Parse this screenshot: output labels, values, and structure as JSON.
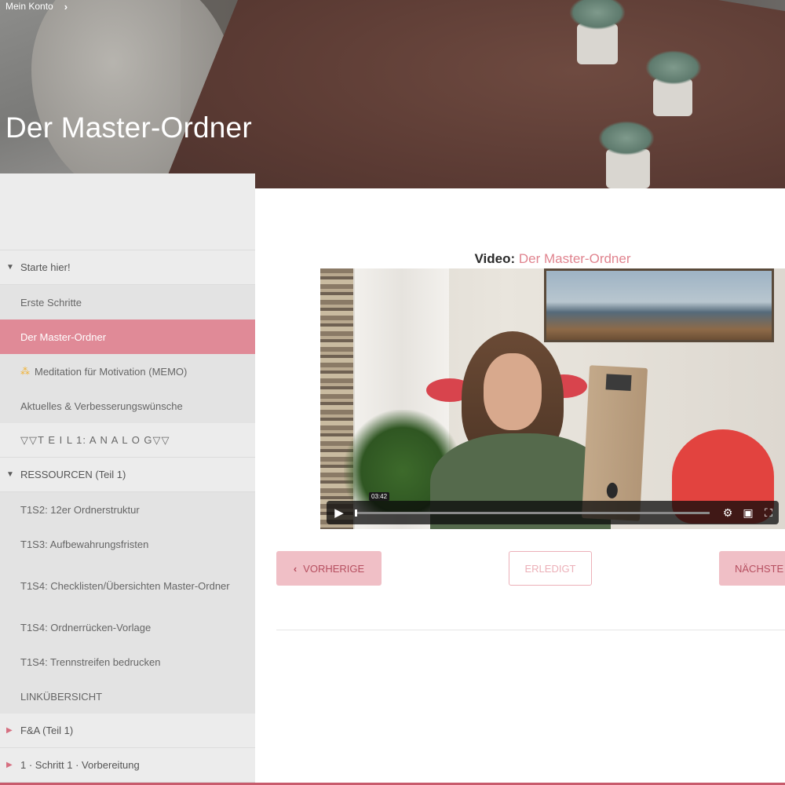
{
  "hero": {
    "breadcrumb": {
      "items": [
        {
          "label": "Mein Konto"
        }
      ],
      "separator_icon": "chevron-right-icon"
    },
    "title": "Der Master-Ordner"
  },
  "sidebar": {
    "sections": [
      {
        "label": "Starte hier!",
        "state": "expanded",
        "items": [
          {
            "label": "Erste Schritte"
          },
          {
            "label": "Der Master-Ordner",
            "active": true
          },
          {
            "label": "Meditation für Motivation (MEMO)",
            "icon": "triad-icon"
          },
          {
            "label": "Aktuelles & Verbesserungswünsche"
          },
          {
            "label": "▽▽T E I L 1: A N A L O G▽▽"
          }
        ]
      },
      {
        "label": "RESSOURCEN (Teil 1)",
        "state": "expanded",
        "items": [
          {
            "label": "T1S2: 12er Ordnerstruktur"
          },
          {
            "label": "T1S3: Aufbewahrungsfristen"
          },
          {
            "label": "T1S4: Checklisten/Übersichten Master-Ordner"
          },
          {
            "label": "T1S4: Ordnerrücken-Vorlage"
          },
          {
            "label": "T1S4: Trennstreifen bedrucken"
          },
          {
            "label": "LINKÜBERSICHT"
          }
        ]
      },
      {
        "label": "F&A (Teil 1)",
        "state": "collapsed"
      },
      {
        "label": "1 · Schritt 1 · Vorbereitung",
        "state": "collapsed"
      }
    ]
  },
  "content": {
    "video_heading": {
      "prefix": "Video:",
      "title": "Der Master-Ordner"
    },
    "player": {
      "timestamp": "03:42",
      "progress": 0.0
    },
    "buttons": {
      "previous": "VORHERIGE",
      "done": "ERLEDIGT",
      "next": "NÄCHSTE"
    }
  },
  "colors": {
    "accent": "#e08a97",
    "accent_light": "#f0bfc6",
    "accent_text": "#b64f60",
    "sidebar_bg": "#ececec"
  }
}
